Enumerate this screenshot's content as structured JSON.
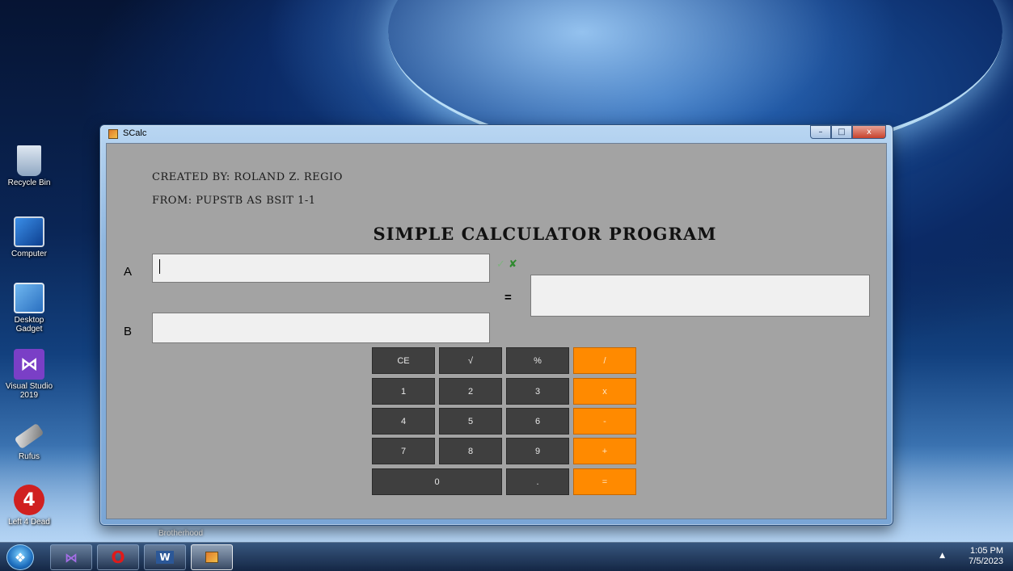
{
  "desktop": {
    "icons": [
      {
        "label": "Recycle Bin"
      },
      {
        "label": "Computer"
      },
      {
        "label": "Desktop Gadget"
      },
      {
        "label": "Visual Studio 2019"
      },
      {
        "label": "Rufus"
      },
      {
        "label": "Left 4 Dead"
      }
    ],
    "hover_label": "Brotherhood"
  },
  "window": {
    "title": "SCalc",
    "controls": {
      "minimize": "–",
      "maximize": "□",
      "close": "x"
    }
  },
  "app": {
    "created_by": "CREATED BY: ROLAND Z. REGIO",
    "from": "FROM: PUPSTB AS BSIT 1-1",
    "heading": "SIMPLE CALCULATOR PROGRAM",
    "label_a": "A",
    "label_b": "B",
    "input_a": "",
    "input_b": "",
    "result": "",
    "equals": "=",
    "check_icon": "✓",
    "x_icon": "✘"
  },
  "keypad": {
    "row1": [
      "CE",
      "√",
      "%",
      "/"
    ],
    "row2": [
      "1",
      "2",
      "3",
      "x"
    ],
    "row3": [
      "4",
      "5",
      "6",
      "-"
    ],
    "row4": [
      "7",
      "8",
      "9",
      "+"
    ],
    "row5": [
      "0",
      ".",
      "="
    ],
    "operator_color": "#ff8a00",
    "digit_color": "#3f3f3f"
  },
  "taskbar": {
    "time": "1:05 PM",
    "date": "7/5/2023",
    "apps": [
      "visual-studio-icon",
      "opera-icon",
      "word-icon",
      "scalc-icon"
    ]
  }
}
